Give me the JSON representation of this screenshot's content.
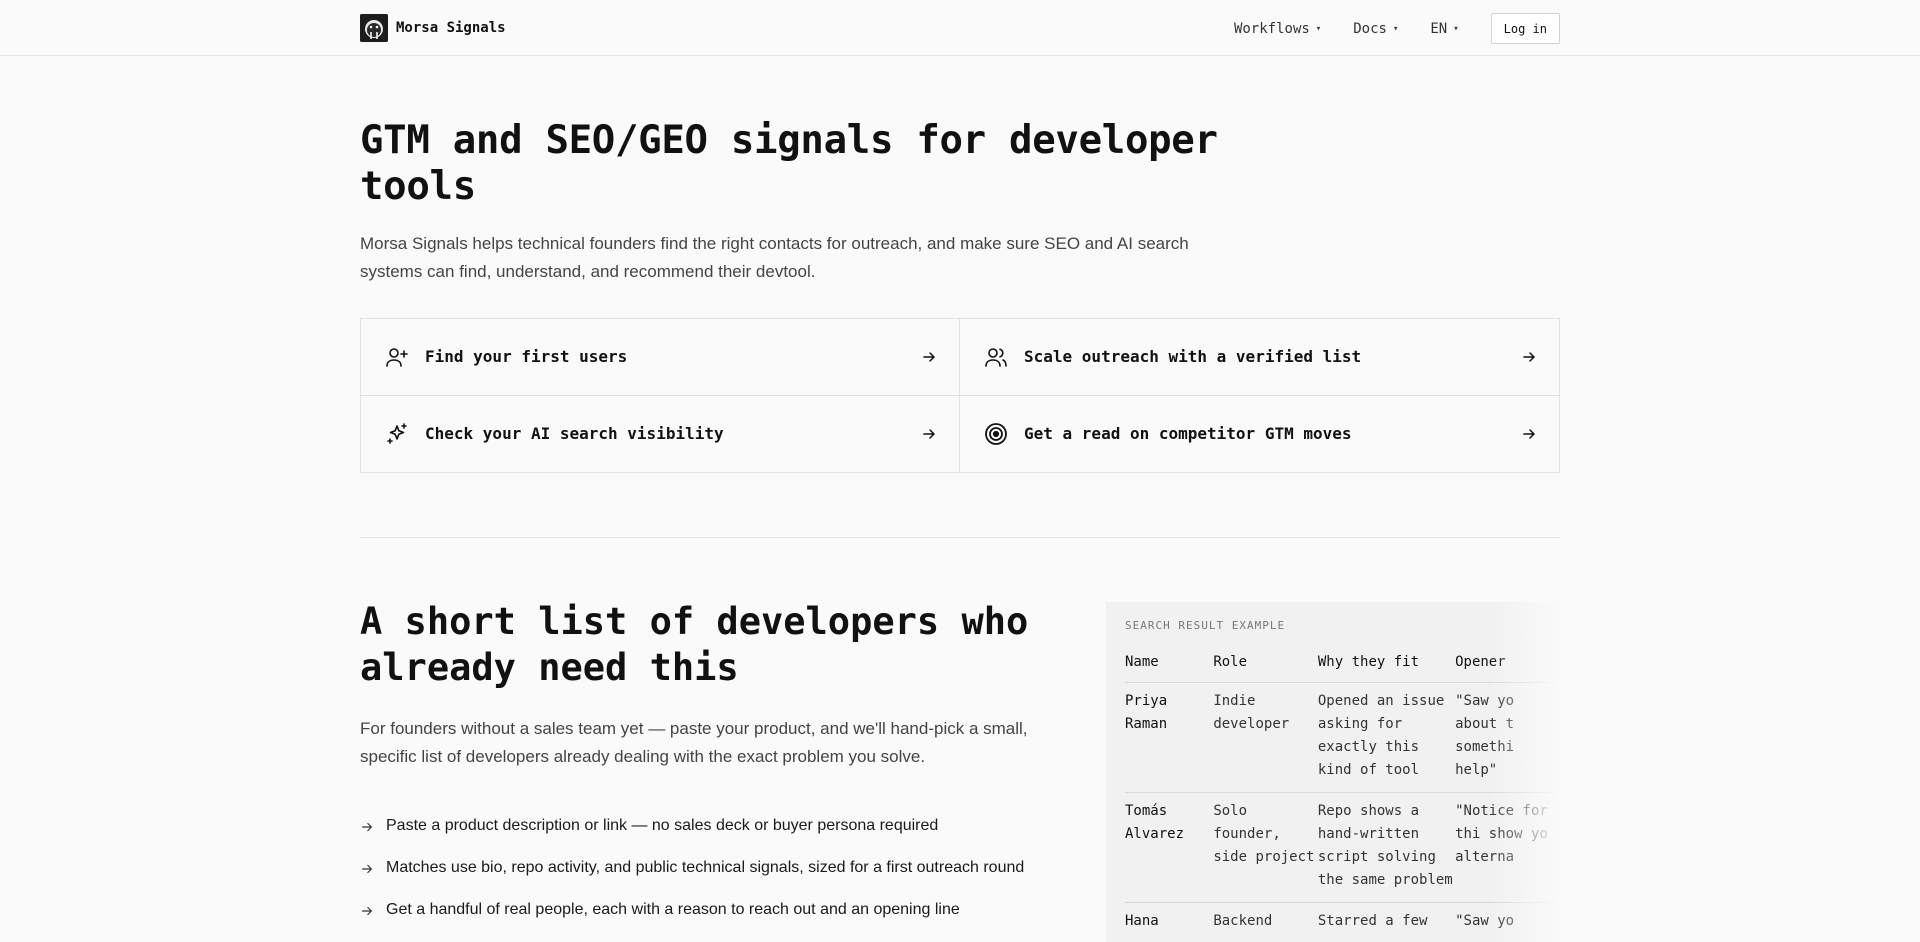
{
  "header": {
    "brand": "Morsa Signals",
    "nav": [
      {
        "label": "Workflows",
        "caret": "▾"
      },
      {
        "label": "Docs",
        "caret": "▾"
      },
      {
        "label": "EN",
        "caret": "▾"
      }
    ],
    "login": "Log in"
  },
  "hero": {
    "title": "GTM and SEO/GEO signals for developer tools",
    "subtitle": "Morsa Signals helps technical founders find the right contacts for outreach, and make sure SEO and AI search systems can find, understand, and recommend their devtool."
  },
  "cards": [
    {
      "label": "Find your first users",
      "icon": "user-plus-icon"
    },
    {
      "label": "Scale outreach with a verified list",
      "icon": "users-icon"
    },
    {
      "label": "Check your AI search visibility",
      "icon": "sparkles-icon"
    },
    {
      "label": "Get a read on competitor GTM moves",
      "icon": "target-icon"
    }
  ],
  "section2": {
    "title": "A short list of developers who already need this",
    "subtitle": "For founders without a sales team yet — paste your product, and we'll hand-pick a small, specific list of developers already dealing with the exact problem you solve.",
    "bullets": [
      "Paste a product description or link — no sales deck or buyer persona required",
      "Matches use bio, repo activity, and public technical signals, sized for a first outreach round",
      "Get a handful of real people, each with a reason to reach out and an opening line"
    ]
  },
  "example": {
    "label": "SEARCH RESULT EXAMPLE",
    "columns": [
      "Name",
      "Role",
      "Why they fit",
      "Opener"
    ],
    "rows": [
      [
        "Priya Raman",
        "Indie developer",
        "Opened an issue asking for exactly this kind of tool",
        "\"Saw yo\nabout t\nsomethi\nhelp\""
      ],
      [
        "Tomás Alvarez",
        "Solo founder, side project",
        "Repo shows a hand-written script solving the same problem",
        "\"Notice\nfor thi\nshow yo\nalterna"
      ],
      [
        "Hana",
        "Backend",
        "Starred a few",
        "\"Saw yo"
      ]
    ]
  },
  "colors": {
    "background": "#fafafa",
    "text": "#111111",
    "muted": "#444444",
    "border": "#e2e2e2",
    "panel": "#f1f1f1"
  }
}
